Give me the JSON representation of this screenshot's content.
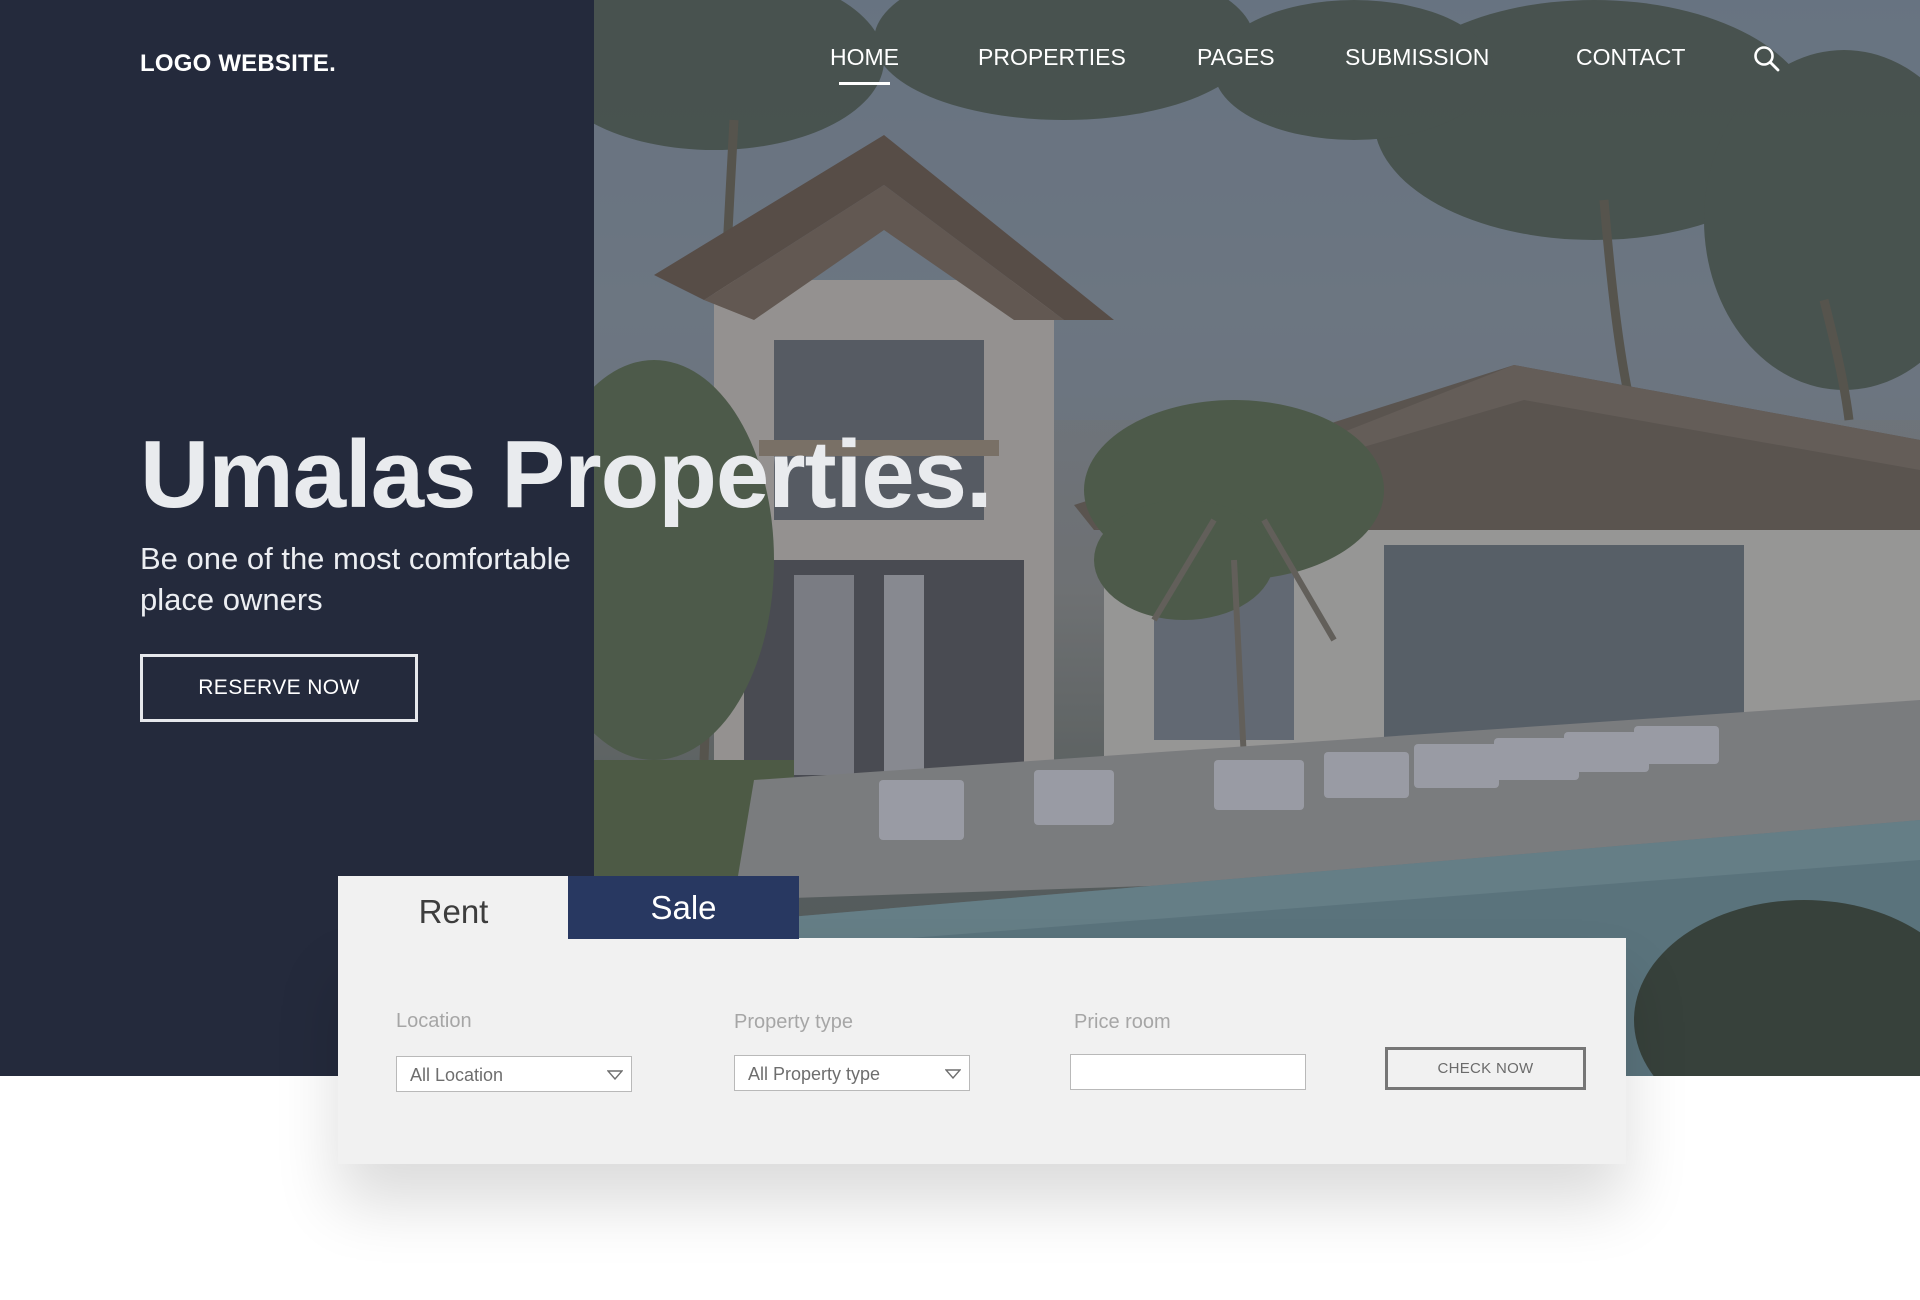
{
  "header": {
    "logo": "LOGO WEBSITE.",
    "nav": [
      {
        "label": "HOME",
        "active": true
      },
      {
        "label": "PROPERTIES",
        "active": false
      },
      {
        "label": "PAGES",
        "active": false
      },
      {
        "label": "SUBMISSION",
        "active": false
      },
      {
        "label": "CONTACT",
        "active": false
      }
    ],
    "search_icon": "search-icon"
  },
  "hero": {
    "title": "Umalas Properties.",
    "subtitle": "Be one of the most comfortable place owners",
    "cta_label": "RESERVE NOW"
  },
  "search": {
    "tabs": [
      {
        "label": "Rent",
        "selected": true
      },
      {
        "label": "Sale",
        "selected": false
      }
    ],
    "fields": {
      "location": {
        "label": "Location",
        "value": "All Location"
      },
      "property_type": {
        "label": "Property type",
        "value": "All Property type"
      },
      "price": {
        "label": "Price room",
        "value": ""
      }
    },
    "submit_label": "CHECK NOW"
  },
  "colors": {
    "dark_panel": "#242a3c",
    "sale_tab": "#283861",
    "search_panel": "#f1f1f1"
  }
}
